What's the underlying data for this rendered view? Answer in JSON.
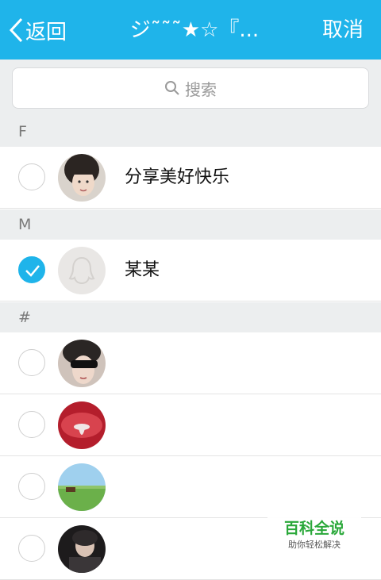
{
  "header": {
    "back_label": "返回",
    "title": "ジ˜˜˜★☆『...",
    "cancel_label": "取消",
    "bar_color": "#1fb4ea"
  },
  "search": {
    "placeholder": "搜索"
  },
  "sections": [
    {
      "letter": "F",
      "contacts": [
        {
          "name": "分享美好快乐",
          "checked": false,
          "avatar": "photo-girl"
        }
      ]
    },
    {
      "letter": "M",
      "contacts": [
        {
          "name": "某某",
          "checked": true,
          "avatar": "default-penguin-avatar"
        }
      ]
    },
    {
      "letter": "#",
      "contacts": [
        {
          "name": "",
          "checked": false,
          "avatar": "photo-sunglasses"
        },
        {
          "name": "",
          "checked": false,
          "avatar": "photo-red"
        },
        {
          "name": "",
          "checked": false,
          "avatar": "photo-landscape"
        },
        {
          "name": "",
          "checked": false,
          "avatar": "photo-dark"
        }
      ]
    }
  ],
  "watermark": {
    "main": "百科全说",
    "sub": "助你轻松解决"
  }
}
